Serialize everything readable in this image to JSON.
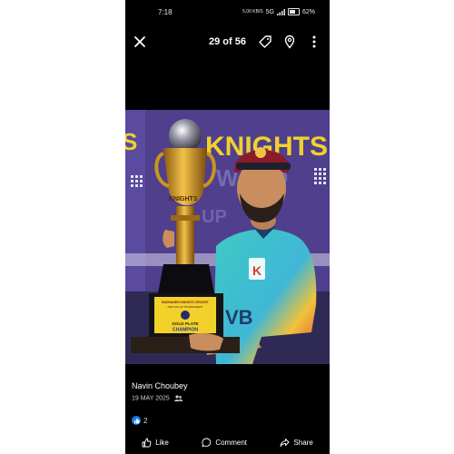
{
  "status_bar": {
    "time": "7:18",
    "net_speed": "5.00 KB/S",
    "signal": "5G",
    "battery": "62%"
  },
  "viewer": {
    "counter": "29 of 56"
  },
  "photo": {
    "banner_text": "KNIGHTS",
    "banner_text_2": "WARD",
    "plate_line1": "BUDHANEH KNIGHTS CRICKET",
    "plate_line2": "2ND SALLIS TOURNAMENT",
    "plate_line3": "GOLD PLATE",
    "plate_line4": "CHAMPION",
    "trophy_text": "KNIGHTS",
    "jersey_text": "VB"
  },
  "post": {
    "author": "Navin Choubey",
    "date": "19 MAY 2025",
    "like_count": "2"
  },
  "actions": {
    "like": "Like",
    "comment": "Comment",
    "share": "Share"
  },
  "colors": {
    "background": "#000000",
    "like_blue": "#1877f2",
    "banner_purple": "#4f3f8c",
    "banner_yellow": "#f2d12a",
    "trophy_gold": "#d9a520"
  }
}
